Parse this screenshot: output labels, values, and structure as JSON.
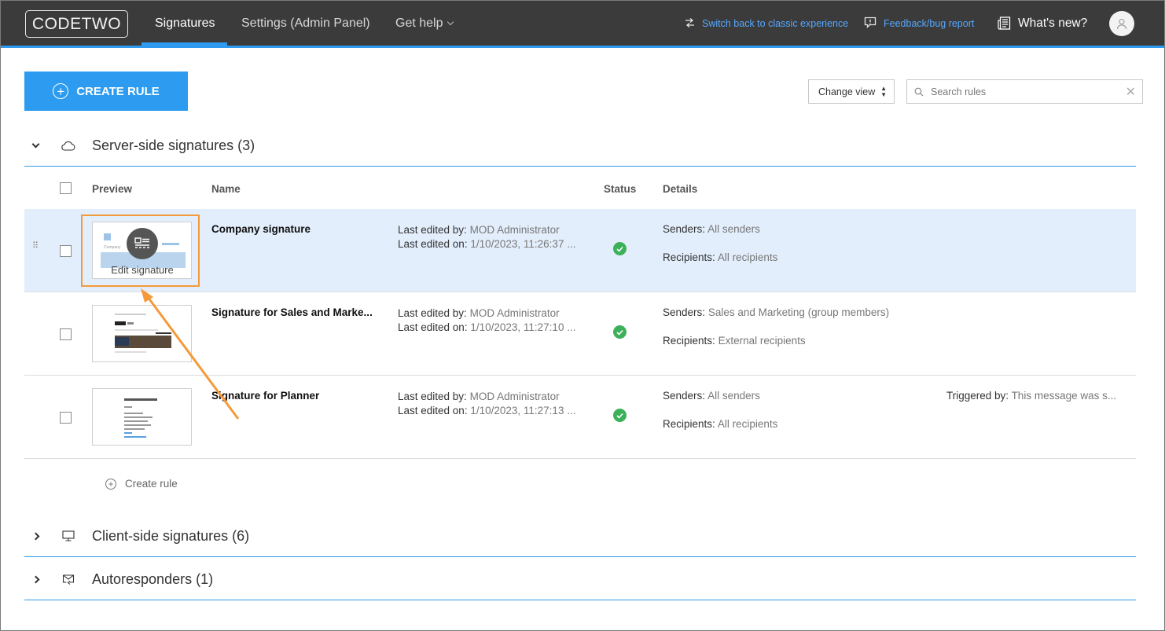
{
  "brand": {
    "logo_text_a": "CODE",
    "logo_text_b": "TWO"
  },
  "nav": {
    "signatures": "Signatures",
    "settings": "Settings (Admin Panel)",
    "get_help": "Get help"
  },
  "top_links": {
    "switch_classic": "Switch back to classic experience",
    "feedback": "Feedback/bug report",
    "whats_new": "What's new?"
  },
  "toolbar": {
    "create_rule": "CREATE RULE",
    "change_view": "Change view",
    "search_placeholder": "Search rules"
  },
  "sections": {
    "server": "Server-side signatures (3)",
    "client": "Client-side signatures (6)",
    "autoresponders": "Autoresponders (1)"
  },
  "table": {
    "headers": {
      "preview": "Preview",
      "name": "Name",
      "status": "Status",
      "details": "Details"
    },
    "rows": [
      {
        "name": "Company signature",
        "edited_by_label": "Last edited by:",
        "edited_by": "MOD Administrator",
        "edited_on_label": "Last edited on:",
        "edited_on": "1/10/2023, 11:26:37 ...",
        "senders_label": "Senders:",
        "senders": "All senders",
        "recipients_label": "Recipients:",
        "recipients": "All recipients"
      },
      {
        "name": "Signature for Sales and Marke...",
        "edited_by_label": "Last edited by:",
        "edited_by": "MOD Administrator",
        "edited_on_label": "Last edited on:",
        "edited_on": "1/10/2023, 11:27:10 ...",
        "senders_label": "Senders:",
        "senders": "Sales and Marketing (group members)",
        "recipients_label": "Recipients:",
        "recipients": "External recipients"
      },
      {
        "name": "Signature for Planner",
        "edited_by_label": "Last edited by:",
        "edited_by": "MOD Administrator",
        "edited_on_label": "Last edited on:",
        "edited_on": "1/10/2023, 11:27:13 ...",
        "senders_label": "Senders:",
        "senders": "All senders",
        "recipients_label": "Recipients:",
        "recipients": "All recipients",
        "triggered_label": "Triggered by:",
        "triggered": "This message was s..."
      }
    ]
  },
  "edit_signature": "Edit signature",
  "create_rule_link": "Create rule",
  "colors": {
    "accent": "#2d9cf0",
    "topbar": "#3b3b3b",
    "selected_row": "#e3eefc",
    "highlight": "#f59a3a",
    "status_ok": "#3cb15a"
  }
}
